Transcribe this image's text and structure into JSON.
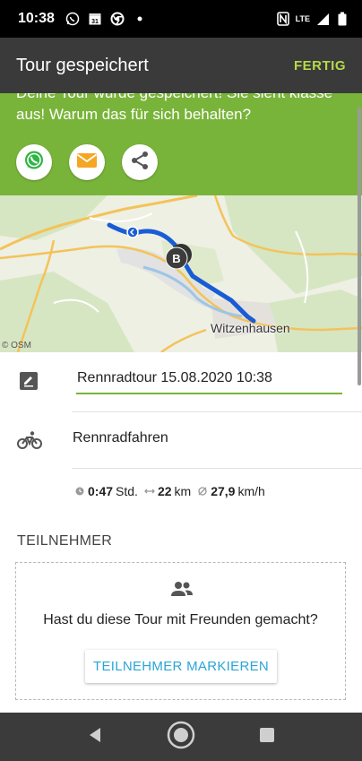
{
  "status_bar": {
    "time": "10:38",
    "network": "LTE",
    "icons": [
      "whatsapp-icon",
      "calendar-icon",
      "chrome-icon",
      "dot-icon",
      "nfc-icon",
      "signal-icon",
      "battery-icon"
    ],
    "calendar_day": "31"
  },
  "app_bar": {
    "title": "Tour gespeichert",
    "action": "FERTIG"
  },
  "share_panel": {
    "message": "Deine Tour wurde gespeichert! Sie sieht klasse aus! Warum das für sich behalten?",
    "buttons": [
      "whatsapp-icon",
      "email-icon",
      "share-icon"
    ]
  },
  "map": {
    "place_label": "Witzenhausen",
    "attribution": "© OSM",
    "start_marker": "B"
  },
  "tour": {
    "name_value": "Rennradtour 15.08.2020 10:38",
    "sport": "Rennradfahren",
    "duration_value": "0:47",
    "duration_unit": "Std.",
    "distance_value": "22",
    "distance_unit": "km",
    "speed_value": "27,9",
    "speed_unit": "km/h"
  },
  "participants": {
    "section_title": "TEILNEHMER",
    "question": "Hast du diese Tour mit Freunden gemacht?",
    "button_label": "TEILNEHMER MARKIEREN"
  },
  "colors": {
    "accent_green": "#79b43a",
    "action_yellow": "#b5d94a",
    "link_blue": "#2aa5d8",
    "route_blue": "#1a5cd6"
  }
}
